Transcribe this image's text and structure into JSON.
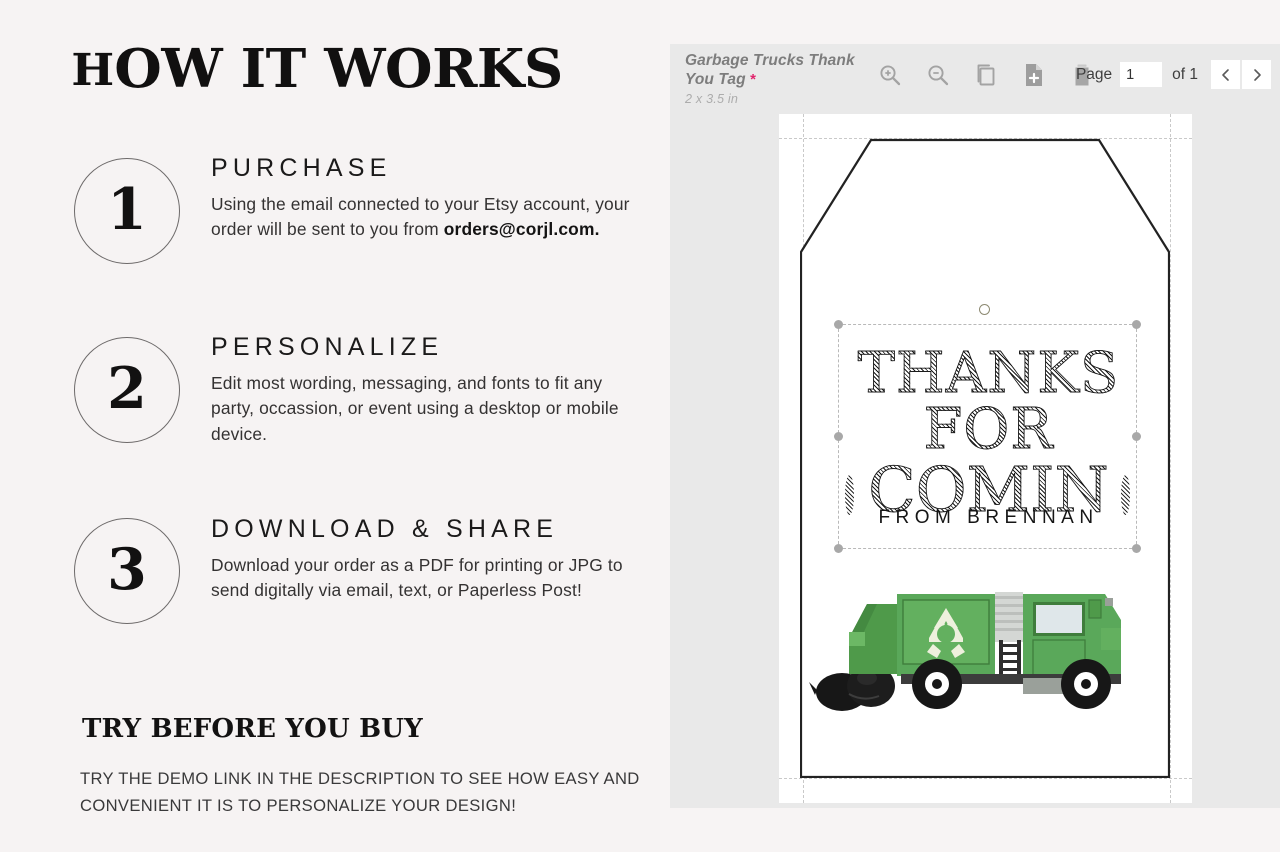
{
  "left": {
    "title": "HOW IT WORKS",
    "title_initial": "H",
    "title_rest": "OW IT WORKS",
    "steps": [
      {
        "number": "1",
        "heading": "PURCHASE",
        "text_before": "Using the email connected to your Etsy account, your order will be sent to you from ",
        "text_bold": "orders@corjl.com.",
        "text_after": ""
      },
      {
        "number": "2",
        "heading": "PERSONALIZE",
        "text_before": "Edit most wording, messaging, and fonts to fit any party, occassion, or event using a desktop or mobile device.",
        "text_bold": "",
        "text_after": ""
      },
      {
        "number": "3",
        "heading": "DOWNLOAD & SHARE",
        "text_before": "Download your order as a PDF for printing or JPG to send digitally via email, text, or Paperless Post!",
        "text_bold": "",
        "text_after": ""
      }
    ],
    "try_heading": "TRY BEFORE YOU BUY",
    "try_text": "TRY THE DEMO LINK IN THE DESCRIPTION TO SEE HOW EASY AND CONVENIENT IT IS TO PERSONALIZE YOUR DESIGN!"
  },
  "editor": {
    "doc_title": "Garbage Trucks Thank You Tag",
    "doc_title_required_marker": "*",
    "doc_size": "2 x 3.5 in",
    "tools": [
      {
        "name": "zoom-in-icon",
        "label": "Zoom In"
      },
      {
        "name": "zoom-out-icon",
        "label": "Zoom Out"
      },
      {
        "name": "duplicate-page-icon",
        "label": "Duplicate Page"
      },
      {
        "name": "add-page-icon",
        "label": "Add Page"
      },
      {
        "name": "delete-page-icon",
        "label": "Delete Page"
      }
    ],
    "page_label": "Page",
    "page_value": "1",
    "page_of": "of 1",
    "prev_label": "‹",
    "next_label": "›",
    "colors": {
      "panel_bg": "#e9e9e9",
      "canvas_bg": "#ffffff",
      "title_gray": "#7d7d7d",
      "required_pink": "#e0246c",
      "handle_gray": "#a8a8a8"
    }
  },
  "design": {
    "line1": "THANKS",
    "line2": "FOR",
    "line3": "COMIN",
    "from_line": "FROM BRENNAN",
    "artwork": "garbage-truck",
    "colors": {
      "truck_green": "#5aa85a",
      "truck_green_dark": "#45853f",
      "truck_green_mid": "#63b05f",
      "ladder_gray": "#cfd2cf",
      "tire_black": "#161616",
      "bag_black": "#151515",
      "recycle_cream": "#eef0dd"
    }
  }
}
